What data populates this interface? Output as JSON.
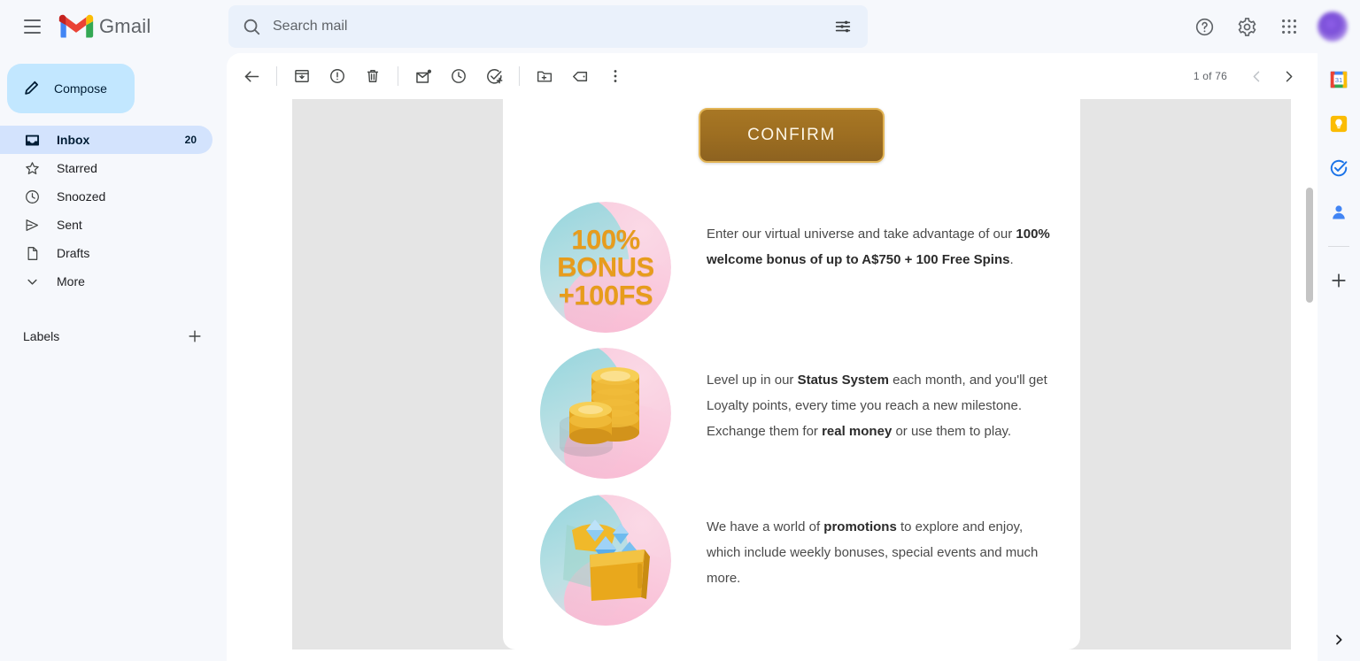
{
  "app": {
    "brand": "Gmail",
    "brand_logo_icon": "gmail-m-logo"
  },
  "search": {
    "placeholder": "Search mail",
    "value": "",
    "search_icon": "search-icon",
    "options_icon": "search-options-icon"
  },
  "header": {
    "menu_icon": "hamburger-menu-icon",
    "help_icon": "help-circle-icon",
    "settings_icon": "gear-icon",
    "apps_icon": "apps-grid-icon",
    "avatar_icon": "user-avatar"
  },
  "sidebar": {
    "compose_label": "Compose",
    "compose_icon": "pencil-icon",
    "items": [
      {
        "label": "Inbox",
        "count": "20",
        "icon": "inbox-icon",
        "active": true
      },
      {
        "label": "Starred",
        "count": "",
        "icon": "star-icon",
        "active": false
      },
      {
        "label": "Snoozed",
        "count": "",
        "icon": "clock-icon",
        "active": false
      },
      {
        "label": "Sent",
        "count": "",
        "icon": "send-icon",
        "active": false
      },
      {
        "label": "Drafts",
        "count": "",
        "icon": "draft-icon",
        "active": false
      },
      {
        "label": "More",
        "count": "",
        "icon": "chevron-down-icon",
        "active": false
      }
    ],
    "labels_title": "Labels",
    "labels_add_icon": "plus-icon"
  },
  "toolbar": {
    "buttons": [
      {
        "name": "back-to-inbox",
        "icon": "arrow-left-icon"
      },
      {
        "name": "archive",
        "icon": "archive-icon"
      },
      {
        "name": "report-spam",
        "icon": "report-spam-icon"
      },
      {
        "name": "delete",
        "icon": "trash-icon"
      },
      {
        "name": "mark-unread",
        "icon": "mark-unread-icon"
      },
      {
        "name": "snooze",
        "icon": "clock-icon"
      },
      {
        "name": "add-to-tasks",
        "icon": "task-add-icon"
      },
      {
        "name": "move-to",
        "icon": "folder-move-icon"
      },
      {
        "name": "labels",
        "icon": "label-tag-icon"
      },
      {
        "name": "more-options",
        "icon": "more-vertical-icon"
      }
    ],
    "pager_text": "1 of 76",
    "prev_icon": "chevron-left-icon",
    "next_icon": "chevron-right-icon"
  },
  "email": {
    "confirm_button": "CONFIRM",
    "features": [
      {
        "image_name": "bonus-badge-illustration",
        "badge_line1": "100%",
        "badge_line2": "BONUS",
        "badge_line3": "+100FS",
        "text_parts": [
          {
            "text": "Enter our virtual universe and take advantage of our ",
            "bold": false
          },
          {
            "text": "100% welcome bonus of up to A$750 + 100 Free Spins",
            "bold": true
          },
          {
            "text": ".",
            "bold": false
          }
        ]
      },
      {
        "image_name": "gold-coins-illustration",
        "text_parts": [
          {
            "text": "Level up in our ",
            "bold": false
          },
          {
            "text": "Status System",
            "bold": true
          },
          {
            "text": " each month, and you'll get Loyalty points, every time you reach a new milestone. Exchange them for ",
            "bold": false
          },
          {
            "text": "real money",
            "bold": true
          },
          {
            "text": " or use them to play.",
            "bold": false
          }
        ]
      },
      {
        "image_name": "gem-treasure-box-illustration",
        "text_parts": [
          {
            "text": "We have a world of ",
            "bold": false
          },
          {
            "text": "promotions",
            "bold": true
          },
          {
            "text": " to explore and enjoy, which include weekly bonuses, special events and much more.",
            "bold": false
          }
        ]
      }
    ]
  },
  "rail": {
    "items": [
      {
        "name": "google-calendar-icon",
        "label": "31"
      },
      {
        "name": "google-keep-icon",
        "label": ""
      },
      {
        "name": "google-tasks-icon",
        "label": ""
      },
      {
        "name": "google-contacts-icon",
        "label": ""
      }
    ],
    "add_icon": "plus-icon",
    "expand_icon": "chevron-right-icon"
  },
  "colors": {
    "accent_blue": "#1a73e8",
    "compose_bg": "#c2e7ff",
    "active_nav_bg": "#d3e3fd",
    "confirm_gold": "#a87724",
    "confirm_border": "#e2b455",
    "badge_gold": "#e79c1c"
  }
}
